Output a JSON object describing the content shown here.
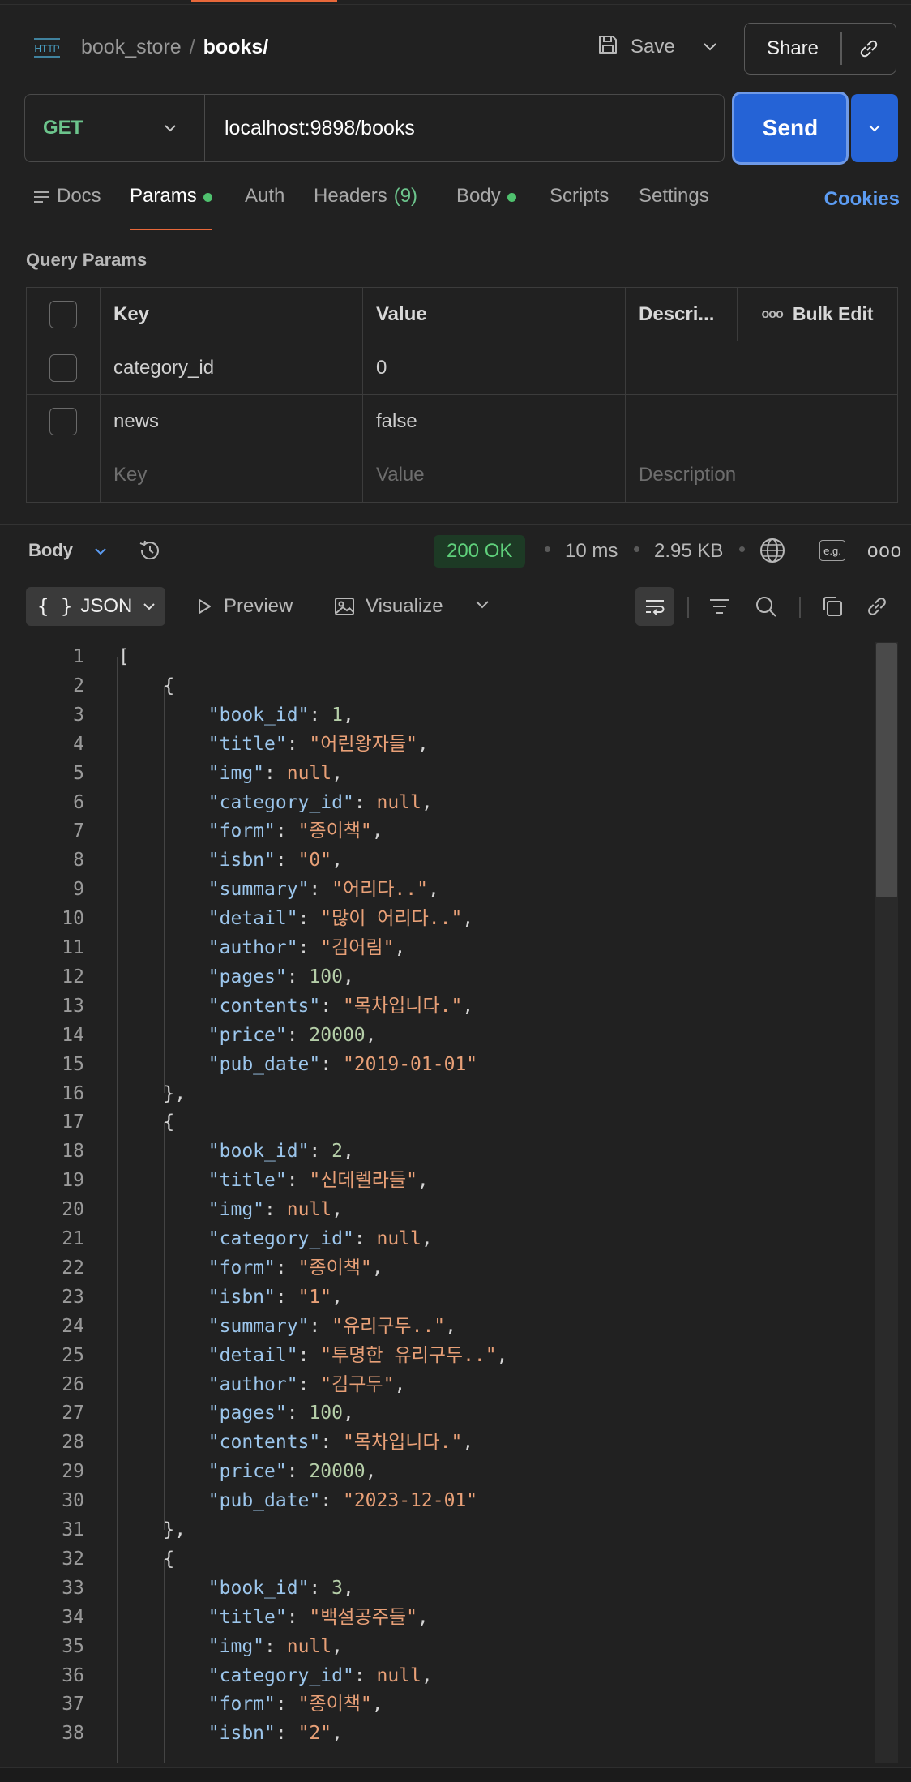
{
  "header": {
    "collection": "book_store",
    "separator": "/",
    "request_name": "books/",
    "save_label": "Save",
    "share_label": "Share"
  },
  "request": {
    "method": "GET",
    "url": "localhost:9898/books",
    "send_label": "Send"
  },
  "tabs": {
    "docs": "Docs",
    "params": "Params",
    "auth": "Auth",
    "headers": "Headers",
    "headers_count": "(9)",
    "body": "Body",
    "scripts": "Scripts",
    "settings": "Settings",
    "cookies": "Cookies"
  },
  "query_params": {
    "title": "Query Params",
    "columns": {
      "key": "Key",
      "value": "Value",
      "description": "Descri...",
      "bulk_edit": "Bulk Edit",
      "bulk_edit_icon": "ooo"
    },
    "rows": [
      {
        "key": "category_id",
        "value": "0",
        "checked": false
      },
      {
        "key": "news",
        "value": "false",
        "checked": false
      }
    ],
    "placeholders": {
      "key": "Key",
      "value": "Value",
      "description": "Description"
    }
  },
  "response": {
    "body_label": "Body",
    "status": "200 OK",
    "time": "10 ms",
    "size": "2.95 KB",
    "eg_label": "e.g.",
    "more_label": "ooo",
    "status_color": "#5fd07b",
    "format": "JSON",
    "format_icon": "{ }",
    "preview_label": "Preview",
    "visualize_label": "Visualize"
  },
  "code_lines": [
    "[",
    "    {",
    "        \"book_id\": 1,",
    "        \"title\": \"어린왕자들\",",
    "        \"img\": null,",
    "        \"category_id\": null,",
    "        \"form\": \"종이책\",",
    "        \"isbn\": \"0\",",
    "        \"summary\": \"어리다..\",",
    "        \"detail\": \"많이 어리다..\",",
    "        \"author\": \"김어림\",",
    "        \"pages\": 100,",
    "        \"contents\": \"목차입니다.\",",
    "        \"price\": 20000,",
    "        \"pub_date\": \"2019-01-01\"",
    "    },",
    "    {",
    "        \"book_id\": 2,",
    "        \"title\": \"신데렐라들\",",
    "        \"img\": null,",
    "        \"category_id\": null,",
    "        \"form\": \"종이책\",",
    "        \"isbn\": \"1\",",
    "        \"summary\": \"유리구두..\",",
    "        \"detail\": \"투명한 유리구두..\",",
    "        \"author\": \"김구두\",",
    "        \"pages\": 100,",
    "        \"contents\": \"목차입니다.\",",
    "        \"price\": 20000,",
    "        \"pub_date\": \"2023-12-01\"",
    "    },",
    "    {",
    "        \"book_id\": 3,",
    "        \"title\": \"백설공주들\",",
    "        \"img\": null,",
    "        \"category_id\": null,",
    "        \"form\": \"종이책\",",
    "        \"isbn\": \"2\","
  ],
  "colors": {
    "accent": "#e8683a",
    "send_button": "#2563d6",
    "method_get": "#6cc48c",
    "cookies_link": "#5c9cf2",
    "json_key": "#9cc6ec",
    "json_string": "#e8a077",
    "json_number": "#b5cea8"
  },
  "icons": {
    "http": "http-icon",
    "save": "save-icon",
    "link": "link-icon",
    "history": "history-icon",
    "globe": "globe-icon",
    "wrap": "wrap-lines-icon",
    "filter": "filter-icon",
    "search": "search-icon",
    "copy": "copy-icon"
  }
}
